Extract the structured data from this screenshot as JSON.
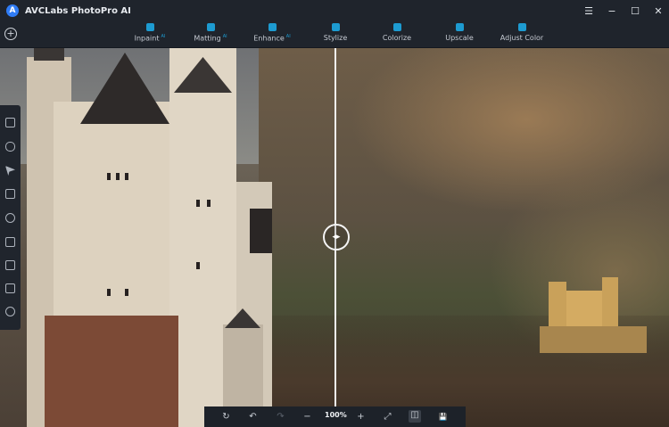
{
  "app": {
    "title": "AVCLabs PhotoPro AI",
    "logo_letter": "A"
  },
  "window_controls": {
    "menu": "☰",
    "minimize": "−",
    "maximize": "☐",
    "close": "✕"
  },
  "toolbar": {
    "add_label": "+",
    "tools": [
      {
        "label": "Inpaint",
        "badge": "AI",
        "icon": "inpaint-icon"
      },
      {
        "label": "Matting",
        "badge": "AI",
        "icon": "matting-icon"
      },
      {
        "label": "Enhance",
        "badge": "AI",
        "icon": "enhance-icon"
      },
      {
        "label": "Stylize",
        "badge": "",
        "icon": "stylize-icon"
      },
      {
        "label": "Colorize",
        "badge": "",
        "icon": "colorize-icon"
      },
      {
        "label": "Upscale",
        "badge": "",
        "icon": "upscale-icon"
      },
      {
        "label": "Adjust Color",
        "badge": "",
        "icon": "adjust-color-icon"
      }
    ]
  },
  "canvas": {
    "split_handle_glyph": "◂▸"
  },
  "bottombar": {
    "rotate": "↻",
    "undo": "↶",
    "redo": "↷",
    "zoom_out": "−",
    "zoom": "100%",
    "zoom_in": "+",
    "fit": "⤢",
    "compare": "◫",
    "save": "💾"
  },
  "colors": {
    "accent": "#1d9bd1",
    "logo": "#2f7cf6",
    "bar_bg": "#1f242c"
  }
}
